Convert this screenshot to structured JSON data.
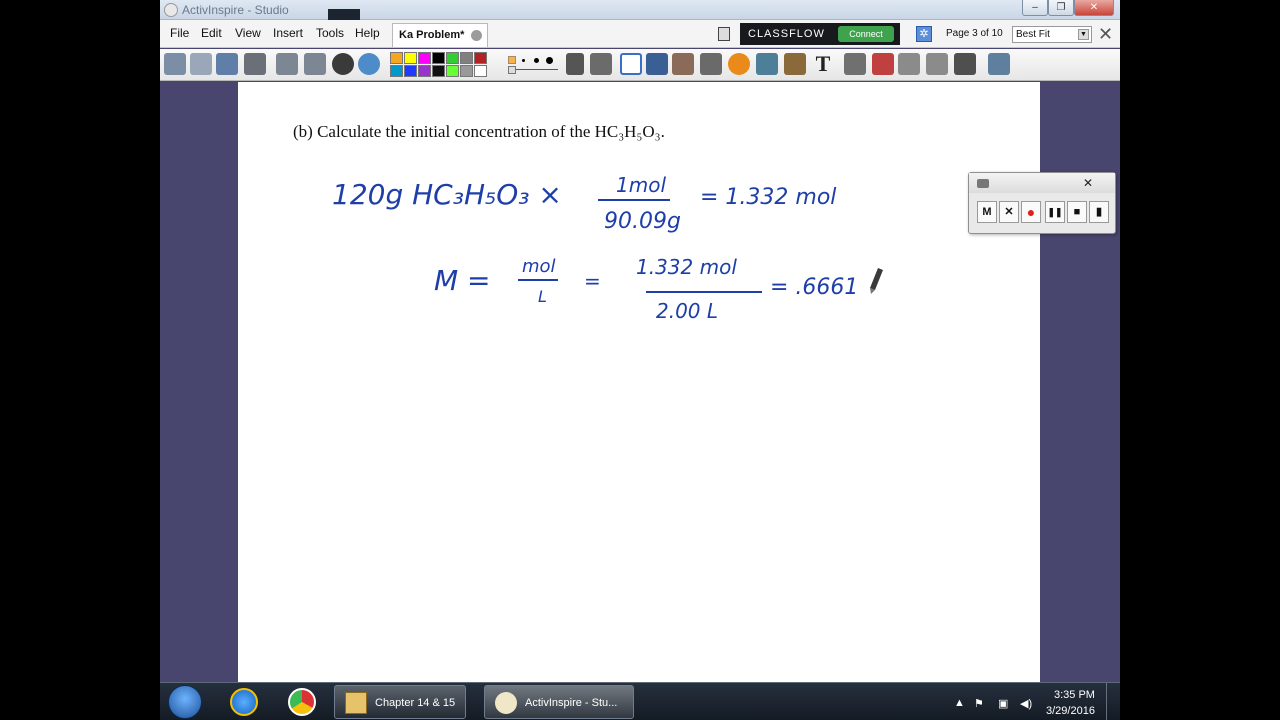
{
  "window": {
    "title": "ActivInspire - Studio"
  },
  "menu": {
    "items": [
      "File",
      "Edit",
      "View",
      "Insert",
      "Tools",
      "Help"
    ],
    "doc_tab": "Ka Problem*",
    "classflow_label": "CLASSFLOW",
    "connect_label": "Connect",
    "page_indicator": "Page 3 of 10",
    "zoom_value": "Best Fit"
  },
  "toolbar": {
    "palette_colors": [
      "#f5a623",
      "#ffff00",
      "#ff00ff",
      "#000000",
      "#33cc33",
      "#808080",
      "#b22222",
      "#0099cc",
      "#1f3bff",
      "#9933cc",
      "#111111",
      "#66ff33",
      "#999999",
      "#ffffff"
    ]
  },
  "page": {
    "question": "(b) Calculate the initial concentration of the HC₃H₅O₃.",
    "handwriting": {
      "line1_left": "120g HC₃H₅O₃ ×",
      "line1_num": "1mol",
      "line1_den": "90.09g",
      "line1_result": "= 1.332 mol",
      "line2_M": "M =",
      "line2_num": "mol",
      "line2_den": "L",
      "line2_eq": "=",
      "line2_num2": "1.332 mol",
      "line2_den2": "2.00 L",
      "line2_result": "= .6661"
    }
  },
  "recorder": {
    "buttons": [
      "M",
      "✕",
      "●",
      "❚❚",
      "■",
      "▮"
    ],
    "close": "✕"
  },
  "taskbar": {
    "tasks": [
      "Chapter 14 & 15",
      "ActivInspire - Stu..."
    ],
    "time": "3:35 PM",
    "date": "3/29/2016"
  }
}
